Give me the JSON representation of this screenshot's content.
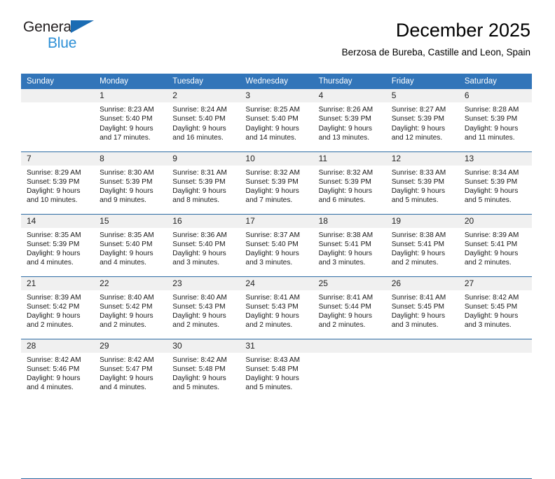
{
  "brand": {
    "name_part1": "General",
    "name_part2": "Blue",
    "triangle_icon": "triangle-icon"
  },
  "header": {
    "title": "December 2025",
    "subtitle": "Berzosa de Bureba, Castille and Leon, Spain"
  },
  "colors": {
    "header_row_bg": "#3275b9",
    "daynum_bg": "#f0f0f0",
    "grid_line": "#2e6ca4",
    "brand_blue_dark": "#1b6cb3",
    "brand_blue_light": "#2c8fd6"
  },
  "calendar": {
    "weekday_headers": [
      "Sunday",
      "Monday",
      "Tuesday",
      "Wednesday",
      "Thursday",
      "Friday",
      "Saturday"
    ],
    "weeks": [
      [
        {
          "day": "",
          "blank": true,
          "sunrise": "",
          "sunset": "",
          "daylight": ""
        },
        {
          "day": "1",
          "sunrise": "Sunrise: 8:23 AM",
          "sunset": "Sunset: 5:40 PM",
          "daylight": "Daylight: 9 hours and 17 minutes."
        },
        {
          "day": "2",
          "sunrise": "Sunrise: 8:24 AM",
          "sunset": "Sunset: 5:40 PM",
          "daylight": "Daylight: 9 hours and 16 minutes."
        },
        {
          "day": "3",
          "sunrise": "Sunrise: 8:25 AM",
          "sunset": "Sunset: 5:40 PM",
          "daylight": "Daylight: 9 hours and 14 minutes."
        },
        {
          "day": "4",
          "sunrise": "Sunrise: 8:26 AM",
          "sunset": "Sunset: 5:39 PM",
          "daylight": "Daylight: 9 hours and 13 minutes."
        },
        {
          "day": "5",
          "sunrise": "Sunrise: 8:27 AM",
          "sunset": "Sunset: 5:39 PM",
          "daylight": "Daylight: 9 hours and 12 minutes."
        },
        {
          "day": "6",
          "sunrise": "Sunrise: 8:28 AM",
          "sunset": "Sunset: 5:39 PM",
          "daylight": "Daylight: 9 hours and 11 minutes."
        }
      ],
      [
        {
          "day": "7",
          "sunrise": "Sunrise: 8:29 AM",
          "sunset": "Sunset: 5:39 PM",
          "daylight": "Daylight: 9 hours and 10 minutes."
        },
        {
          "day": "8",
          "sunrise": "Sunrise: 8:30 AM",
          "sunset": "Sunset: 5:39 PM",
          "daylight": "Daylight: 9 hours and 9 minutes."
        },
        {
          "day": "9",
          "sunrise": "Sunrise: 8:31 AM",
          "sunset": "Sunset: 5:39 PM",
          "daylight": "Daylight: 9 hours and 8 minutes."
        },
        {
          "day": "10",
          "sunrise": "Sunrise: 8:32 AM",
          "sunset": "Sunset: 5:39 PM",
          "daylight": "Daylight: 9 hours and 7 minutes."
        },
        {
          "day": "11",
          "sunrise": "Sunrise: 8:32 AM",
          "sunset": "Sunset: 5:39 PM",
          "daylight": "Daylight: 9 hours and 6 minutes."
        },
        {
          "day": "12",
          "sunrise": "Sunrise: 8:33 AM",
          "sunset": "Sunset: 5:39 PM",
          "daylight": "Daylight: 9 hours and 5 minutes."
        },
        {
          "day": "13",
          "sunrise": "Sunrise: 8:34 AM",
          "sunset": "Sunset: 5:39 PM",
          "daylight": "Daylight: 9 hours and 5 minutes."
        }
      ],
      [
        {
          "day": "14",
          "sunrise": "Sunrise: 8:35 AM",
          "sunset": "Sunset: 5:39 PM",
          "daylight": "Daylight: 9 hours and 4 minutes."
        },
        {
          "day": "15",
          "sunrise": "Sunrise: 8:35 AM",
          "sunset": "Sunset: 5:40 PM",
          "daylight": "Daylight: 9 hours and 4 minutes."
        },
        {
          "day": "16",
          "sunrise": "Sunrise: 8:36 AM",
          "sunset": "Sunset: 5:40 PM",
          "daylight": "Daylight: 9 hours and 3 minutes."
        },
        {
          "day": "17",
          "sunrise": "Sunrise: 8:37 AM",
          "sunset": "Sunset: 5:40 PM",
          "daylight": "Daylight: 9 hours and 3 minutes."
        },
        {
          "day": "18",
          "sunrise": "Sunrise: 8:38 AM",
          "sunset": "Sunset: 5:41 PM",
          "daylight": "Daylight: 9 hours and 3 minutes."
        },
        {
          "day": "19",
          "sunrise": "Sunrise: 8:38 AM",
          "sunset": "Sunset: 5:41 PM",
          "daylight": "Daylight: 9 hours and 2 minutes."
        },
        {
          "day": "20",
          "sunrise": "Sunrise: 8:39 AM",
          "sunset": "Sunset: 5:41 PM",
          "daylight": "Daylight: 9 hours and 2 minutes."
        }
      ],
      [
        {
          "day": "21",
          "sunrise": "Sunrise: 8:39 AM",
          "sunset": "Sunset: 5:42 PM",
          "daylight": "Daylight: 9 hours and 2 minutes."
        },
        {
          "day": "22",
          "sunrise": "Sunrise: 8:40 AM",
          "sunset": "Sunset: 5:42 PM",
          "daylight": "Daylight: 9 hours and 2 minutes."
        },
        {
          "day": "23",
          "sunrise": "Sunrise: 8:40 AM",
          "sunset": "Sunset: 5:43 PM",
          "daylight": "Daylight: 9 hours and 2 minutes."
        },
        {
          "day": "24",
          "sunrise": "Sunrise: 8:41 AM",
          "sunset": "Sunset: 5:43 PM",
          "daylight": "Daylight: 9 hours and 2 minutes."
        },
        {
          "day": "25",
          "sunrise": "Sunrise: 8:41 AM",
          "sunset": "Sunset: 5:44 PM",
          "daylight": "Daylight: 9 hours and 2 minutes."
        },
        {
          "day": "26",
          "sunrise": "Sunrise: 8:41 AM",
          "sunset": "Sunset: 5:45 PM",
          "daylight": "Daylight: 9 hours and 3 minutes."
        },
        {
          "day": "27",
          "sunrise": "Sunrise: 8:42 AM",
          "sunset": "Sunset: 5:45 PM",
          "daylight": "Daylight: 9 hours and 3 minutes."
        }
      ],
      [
        {
          "day": "28",
          "sunrise": "Sunrise: 8:42 AM",
          "sunset": "Sunset: 5:46 PM",
          "daylight": "Daylight: 9 hours and 4 minutes."
        },
        {
          "day": "29",
          "sunrise": "Sunrise: 8:42 AM",
          "sunset": "Sunset: 5:47 PM",
          "daylight": "Daylight: 9 hours and 4 minutes."
        },
        {
          "day": "30",
          "sunrise": "Sunrise: 8:42 AM",
          "sunset": "Sunset: 5:48 PM",
          "daylight": "Daylight: 9 hours and 5 minutes."
        },
        {
          "day": "31",
          "sunrise": "Sunrise: 8:43 AM",
          "sunset": "Sunset: 5:48 PM",
          "daylight": "Daylight: 9 hours and 5 minutes."
        },
        {
          "day": "",
          "blank": true,
          "sunrise": "",
          "sunset": "",
          "daylight": ""
        },
        {
          "day": "",
          "blank": true,
          "sunrise": "",
          "sunset": "",
          "daylight": ""
        },
        {
          "day": "",
          "blank": true,
          "sunrise": "",
          "sunset": "",
          "daylight": ""
        }
      ]
    ]
  }
}
